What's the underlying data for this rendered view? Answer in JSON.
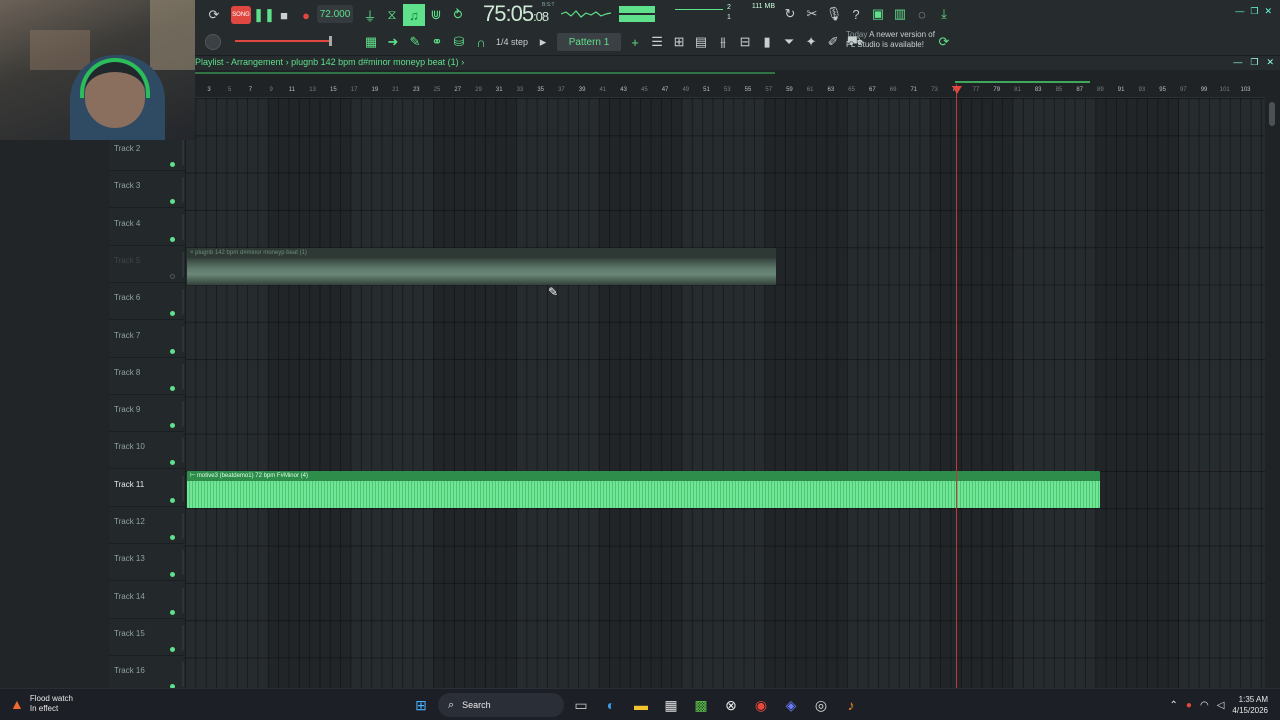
{
  "toolbar": {
    "song_mode": "SONG",
    "tempo": "72.000",
    "time_main": "75:05",
    "time_small": ":08",
    "bst": "B:S:T",
    "cpu_top": "2",
    "cpu_bottom": "1",
    "memory": "111 MB",
    "step": "1/4 step",
    "pattern": "Pattern 1",
    "news_today": "Today",
    "news_line1": "A newer version of",
    "news_line2": "FL Studio is available!"
  },
  "playlist": {
    "title": "Playlist - Arrangement",
    "separator": "›",
    "clip_name": "plugnb 142 bpm d#minor moneyp beat (1)",
    "ruler": [
      "3",
      "5",
      "7",
      "9",
      "11",
      "13",
      "15",
      "17",
      "19",
      "21",
      "23",
      "25",
      "27",
      "29",
      "31",
      "33",
      "35",
      "37",
      "39",
      "41",
      "43",
      "45",
      "47",
      "49",
      "51",
      "53",
      "55",
      "57",
      "59",
      "61",
      "63",
      "65",
      "67",
      "69",
      "71",
      "73",
      "75",
      "77",
      "79",
      "81",
      "83",
      "85",
      "87",
      "89",
      "91",
      "93",
      "95",
      "97",
      "99",
      "101",
      "103"
    ],
    "tracks": [
      {
        "name": "Track 2",
        "state": "normal"
      },
      {
        "name": "Track 3",
        "state": "normal"
      },
      {
        "name": "Track 4",
        "state": "normal"
      },
      {
        "name": "Track 5",
        "state": "muted"
      },
      {
        "name": "Track 6",
        "state": "normal"
      },
      {
        "name": "Track 7",
        "state": "normal"
      },
      {
        "name": "Track 8",
        "state": "normal"
      },
      {
        "name": "Track 9",
        "state": "normal"
      },
      {
        "name": "Track 10",
        "state": "normal"
      },
      {
        "name": "Track 11",
        "state": "selected"
      },
      {
        "name": "Track 12",
        "state": "normal"
      },
      {
        "name": "Track 13",
        "state": "normal"
      },
      {
        "name": "Track 14",
        "state": "normal"
      },
      {
        "name": "Track 15",
        "state": "normal"
      },
      {
        "name": "Track 16",
        "state": "normal"
      }
    ],
    "clips": [
      {
        "label": "× plugnb 142 bpm d#minor moneyp beat (1)",
        "track": "Track 5",
        "muted": true
      },
      {
        "label": "⊢ motive3 (beatdemo1) 72 bpm F#Minor (4)",
        "track": "Track 11",
        "muted": false
      }
    ]
  },
  "taskbar": {
    "weather_title": "Flood watch",
    "weather_sub": "In effect",
    "search": "Search",
    "time": "1:35 AM",
    "date": "4/15/2026"
  },
  "colors": {
    "accent": "#5fe08a",
    "record": "#e0473f",
    "playhead": "#c0373c",
    "background": "#262b2e"
  }
}
